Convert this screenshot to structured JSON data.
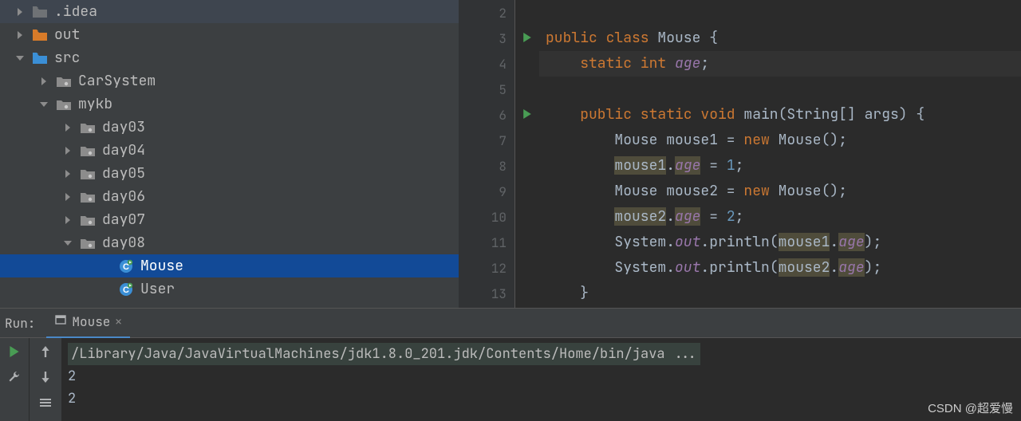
{
  "sidebar": {
    "items": [
      {
        "indent": 20,
        "expand": "right",
        "icon": "folder",
        "color": "#6f7275",
        "label": ".idea"
      },
      {
        "indent": 20,
        "expand": "right",
        "icon": "folder",
        "color": "#d87b29",
        "label": "out"
      },
      {
        "indent": 20,
        "expand": "down",
        "icon": "folder",
        "color": "#3b8fd6",
        "label": "src"
      },
      {
        "indent": 50,
        "expand": "right",
        "icon": "package",
        "color": "",
        "label": "CarSystem"
      },
      {
        "indent": 50,
        "expand": "down",
        "icon": "package",
        "color": "",
        "label": "mykb"
      },
      {
        "indent": 80,
        "expand": "right",
        "icon": "package",
        "color": "",
        "label": "day03"
      },
      {
        "indent": 80,
        "expand": "right",
        "icon": "package",
        "color": "",
        "label": "day04"
      },
      {
        "indent": 80,
        "expand": "right",
        "icon": "package",
        "color": "",
        "label": "day05"
      },
      {
        "indent": 80,
        "expand": "right",
        "icon": "package",
        "color": "",
        "label": "day06"
      },
      {
        "indent": 80,
        "expand": "right",
        "icon": "package",
        "color": "",
        "label": "day07"
      },
      {
        "indent": 80,
        "expand": "down",
        "icon": "package",
        "color": "",
        "label": "day08"
      },
      {
        "indent": 128,
        "expand": "",
        "icon": "class",
        "color": "",
        "label": "Mouse",
        "selected": true
      },
      {
        "indent": 128,
        "expand": "",
        "icon": "class",
        "color": "",
        "label": "User"
      }
    ]
  },
  "editor": {
    "lines": [
      2,
      3,
      4,
      5,
      6,
      7,
      8,
      9,
      10,
      11,
      12,
      13
    ],
    "runmarks": [
      3,
      6
    ],
    "code": {
      "l2": "",
      "l3": {
        "a": "public class ",
        "b": "Mouse {"
      },
      "l4": {
        "a": "    static int ",
        "b": "age",
        "c": ";"
      },
      "l5": "",
      "l6": {
        "a": "    public static void ",
        "b": "main",
        "c": "(String[] args) {"
      },
      "l7": {
        "a": "        Mouse mouse1 = ",
        "b": "new ",
        "c": "Mouse();"
      },
      "l8": {
        "a": "        ",
        "m": "mouse1",
        "d": ".",
        "f": "age",
        "e": " = ",
        "n": "1",
        "s": ";"
      },
      "l9": {
        "a": "        Mouse mouse2 = ",
        "b": "new ",
        "c": "Mouse();"
      },
      "l10": {
        "a": "        ",
        "m": "mouse2",
        "d": ".",
        "f": "age",
        "e": " = ",
        "n": "2",
        "s": ";"
      },
      "l11": {
        "a": "        System.",
        "o": "out",
        "p": ".println(",
        "m": "mouse1",
        "d": ".",
        "f": "age",
        "q": ");"
      },
      "l12": {
        "a": "        System.",
        "o": "out",
        "p": ".println(",
        "m": "mouse2",
        "d": ".",
        "f": "age",
        "q": ");"
      },
      "l13": "    }"
    }
  },
  "run": {
    "panel_label": "Run:",
    "tab_label": "Mouse",
    "cmd": "/Library/Java/JavaVirtualMachines/jdk1.8.0_201.jdk/Contents/Home/bin/java ...",
    "out1": "2",
    "out2": "2"
  },
  "watermark": "CSDN @超爱慢"
}
